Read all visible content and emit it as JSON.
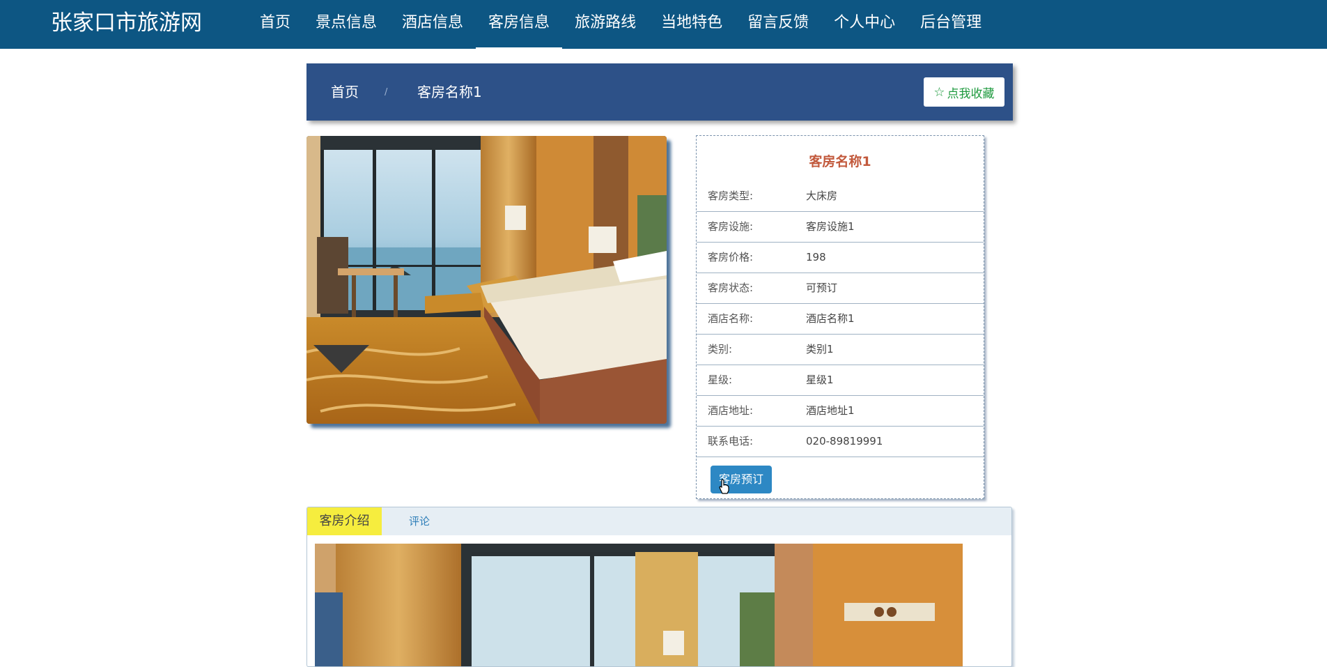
{
  "header": {
    "brand": "张家口市旅游网",
    "nav": [
      "首页",
      "景点信息",
      "酒店信息",
      "客房信息",
      "旅游路线",
      "当地特色",
      "留言反馈",
      "个人中心",
      "后台管理"
    ],
    "active_index": 3
  },
  "breadcrumb": {
    "home": "首页",
    "separator": "/",
    "current": "客房名称1",
    "favorite_label": "点我收藏",
    "favorite_icon": "star-outline-icon"
  },
  "room": {
    "title": "客房名称1",
    "fields": [
      {
        "label": "客房类型:",
        "value": "大床房"
      },
      {
        "label": "客房设施:",
        "value": "客房设施1"
      },
      {
        "label": "客房价格:",
        "value": "198"
      },
      {
        "label": "客房状态:",
        "value": "可预订"
      },
      {
        "label": "酒店名称:",
        "value": "酒店名称1"
      },
      {
        "label": "类别:",
        "value": "类别1"
      },
      {
        "label": "星级:",
        "value": "星级1"
      },
      {
        "label": "酒店地址:",
        "value": "酒店地址1"
      },
      {
        "label": "联系电话:",
        "value": "020-89819991"
      }
    ],
    "book_label": "客房预订"
  },
  "tabs": {
    "intro": "客房介绍",
    "comments": "评论"
  },
  "colors": {
    "header_bg": "#0d5683",
    "breadcrumb_bg": "#2d5188",
    "title_accent": "#c2593c",
    "button_blue": "#2d88c4",
    "tab_active": "#f6ed3e"
  }
}
